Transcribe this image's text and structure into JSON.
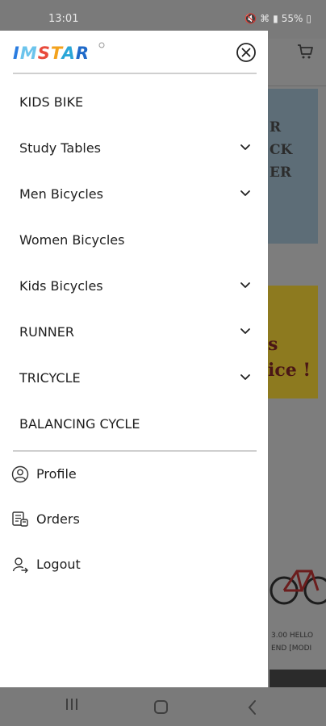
{
  "status_bar": {
    "time": "13:01",
    "battery": "55%",
    "icons": [
      "mute-icon",
      "wifi-icon",
      "signal-icon",
      "battery-icon"
    ]
  },
  "brand": {
    "logo_text": "IMSTAR",
    "logo_letter_colors": [
      "#2b7de0",
      "#6cc4ec",
      "#e84a3c",
      "#f3a21d",
      "#2aa7d8",
      "#1f6ac9"
    ]
  },
  "menu": {
    "items": [
      {
        "label": "KIDS BIKE",
        "has_submenu": false
      },
      {
        "label": "Study Tables",
        "has_submenu": true
      },
      {
        "label": "Men Bicycles",
        "has_submenu": true
      },
      {
        "label": "Women Bicycles",
        "has_submenu": false
      },
      {
        "label": "Kids Bicycles",
        "has_submenu": true
      },
      {
        "label": "RUNNER",
        "has_submenu": true
      },
      {
        "label": "TRICYCLE",
        "has_submenu": true
      },
      {
        "label": "BALANCING CYCLE",
        "has_submenu": false
      }
    ]
  },
  "account": {
    "items": [
      {
        "label": "Profile",
        "icon": "user-circle-icon"
      },
      {
        "label": "Orders",
        "icon": "orders-icon"
      },
      {
        "label": "Logout",
        "icon": "logout-icon"
      }
    ]
  },
  "background": {
    "banner1_lines": [
      "R",
      "CK",
      "ER"
    ],
    "banner2_lines": [
      "s",
      "ice !"
    ],
    "product_text_lines": [
      "3.00 HELLO",
      "END [MODI"
    ]
  }
}
